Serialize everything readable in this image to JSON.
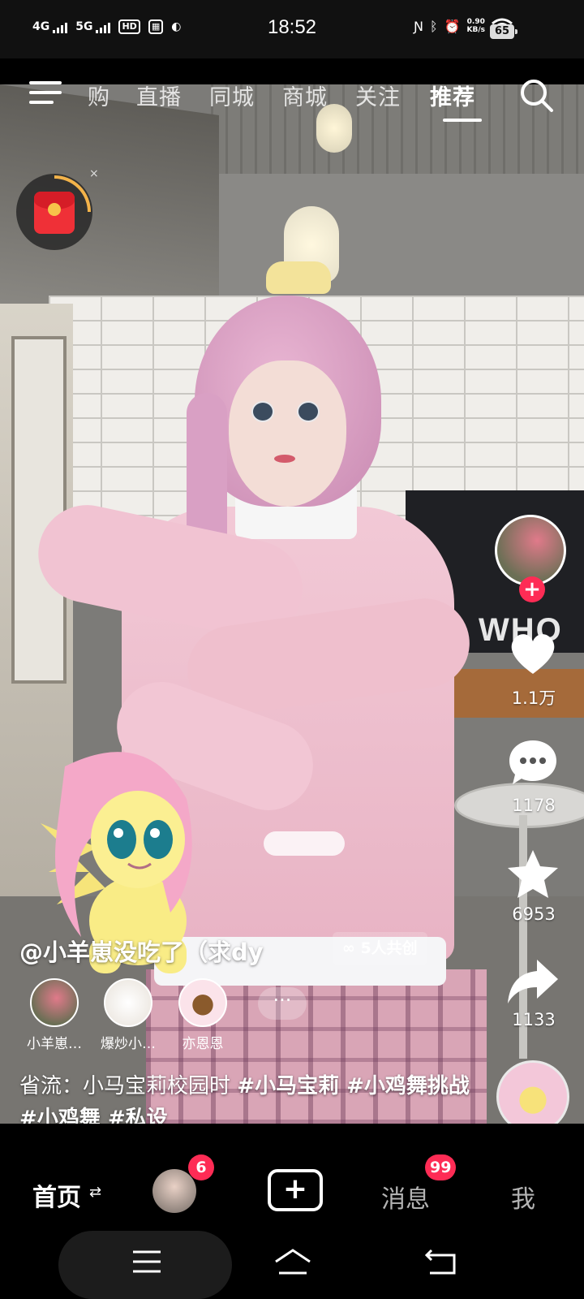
{
  "status_bar": {
    "network_1": "4G",
    "network_2": "5G",
    "hd": "HD",
    "time": "18:52",
    "speed_value": "0.90",
    "speed_unit": "KB/s",
    "battery": "65"
  },
  "top_nav": {
    "tabs": [
      "购",
      "直播",
      "同城",
      "商城",
      "关注",
      "推荐"
    ],
    "active_tab": "推荐"
  },
  "red_packet": {
    "close": "×"
  },
  "right_rail": {
    "likes": "1.1万",
    "comments": "1178",
    "favorites": "6953",
    "shares": "1133"
  },
  "caption": {
    "author": "@小羊崽没吃了（求dy",
    "cocreate": "5人共创",
    "cocreators": [
      "小羊崽…",
      "爆炒小…",
      "亦恩恩"
    ],
    "more": "···",
    "description": "省流：小马宝莉校园时",
    "tags": "#小马宝莉 #小鸡舞挑战 #小鸡舞 #私设"
  },
  "bottom_nav": {
    "home": "首页",
    "home_switch": "⇄",
    "friend_badge": "6",
    "create": "+",
    "messages": "消息",
    "messages_badge": "99",
    "me": "我"
  },
  "colors": {
    "accent": "#fe2c55",
    "background": "#000000"
  },
  "icons": [
    "menu-icon",
    "search-icon",
    "red-packet-icon",
    "heart-icon",
    "comment-icon",
    "star-icon",
    "share-icon",
    "music-disc-icon",
    "recents-icon",
    "home-icon",
    "back-icon"
  ]
}
